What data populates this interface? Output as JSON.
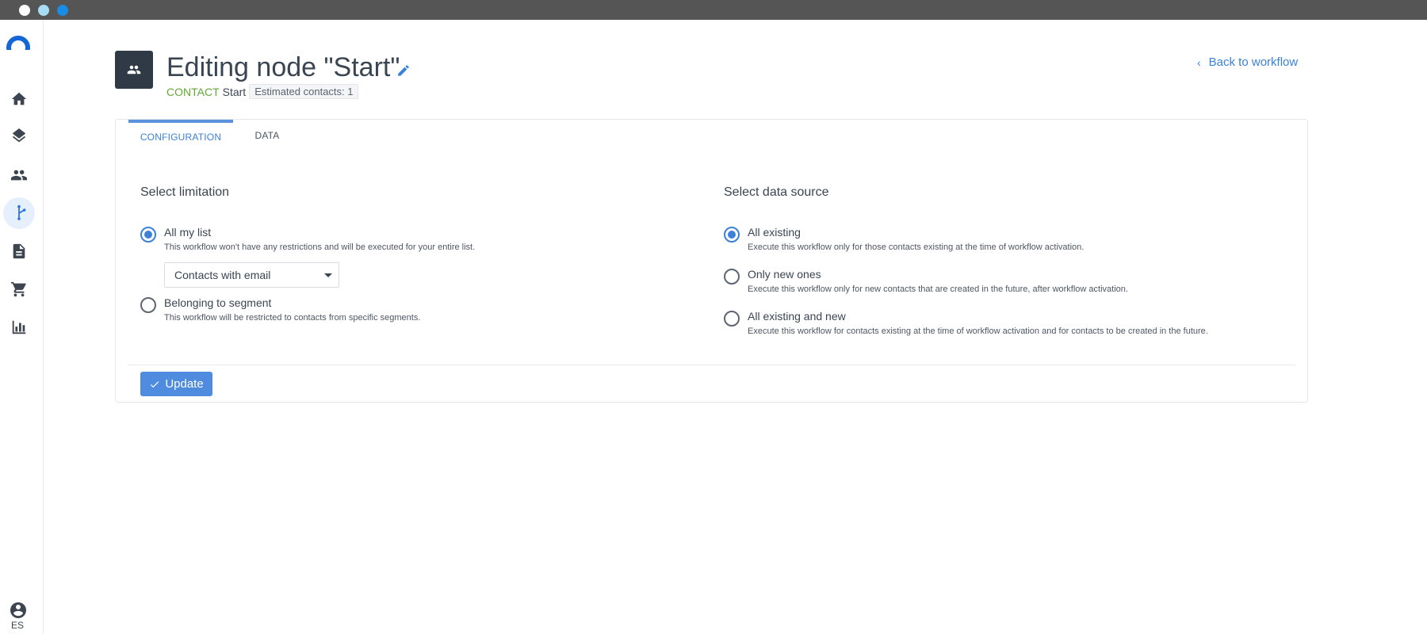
{
  "sidebar": {
    "items": [
      {
        "name": "home-icon"
      },
      {
        "name": "layers-icon"
      },
      {
        "name": "contacts-icon"
      },
      {
        "name": "workflow-icon",
        "active": true
      },
      {
        "name": "document-icon"
      },
      {
        "name": "cart-icon"
      },
      {
        "name": "chart-icon"
      }
    ],
    "user_icon": "account-circle-icon",
    "language": "ES"
  },
  "header": {
    "title": "Editing node \"Start\"",
    "node_type": "CONTACT",
    "node_name": "Start",
    "estimated_contacts": "Estimated contacts: 1",
    "back_link": "Back to workflow"
  },
  "tabs": [
    {
      "label": "CONFIGURATION",
      "active": true
    },
    {
      "label": "DATA",
      "active": false
    }
  ],
  "limitation": {
    "title": "Select limitation",
    "options": [
      {
        "label": "All my list",
        "description": "This workflow won't have any restrictions and will be executed for your entire list.",
        "checked": true
      },
      {
        "label": "Belonging to segment",
        "description": "This workflow will be restricted to contacts from specific segments.",
        "checked": false
      }
    ],
    "select_value": "Contacts with email"
  },
  "data_source": {
    "title": "Select data source",
    "options": [
      {
        "label": "All existing",
        "description": "Execute this workflow only for those contacts existing at the time of workflow activation.",
        "checked": true
      },
      {
        "label": "Only new ones",
        "description": "Execute this workflow only for new contacts that are created in the future, after workflow activation.",
        "checked": false
      },
      {
        "label": "All existing and new",
        "description": "Execute this workflow for contacts existing at the time of workflow activation and for contacts to be created in the future.",
        "checked": false
      }
    ]
  },
  "actions": {
    "update_label": "Update"
  },
  "colors": {
    "accent": "#3b82d6",
    "contact_green": "#63a833",
    "node_icon_bg": "#2f3a46"
  }
}
